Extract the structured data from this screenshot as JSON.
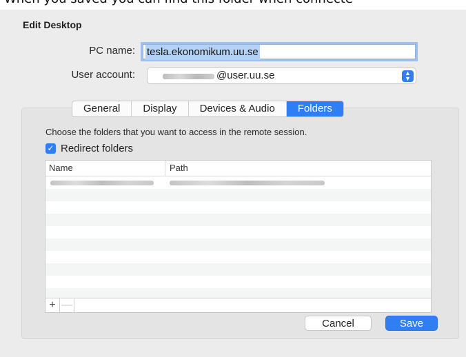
{
  "caption": "When you saved you can find this folder when connecte",
  "dialog": {
    "title": "Edit Desktop",
    "pc_name_label": "PC name:",
    "pc_name_value": "tesla.ekonomikum.uu.se",
    "user_account_label": "User account:",
    "user_account_value": "@user.uu.se"
  },
  "tabs": [
    "General",
    "Display",
    "Devices & Audio",
    "Folders"
  ],
  "active_tab": "Folders",
  "folders": {
    "instruction": "Choose the folders that you want to access in the remote session.",
    "redirect_label": "Redirect folders",
    "redirect_checked": true,
    "columns": {
      "name": "Name",
      "path": "Path"
    },
    "add_symbol": "+",
    "remove_symbol": "—"
  },
  "buttons": {
    "cancel": "Cancel",
    "save": "Save"
  },
  "colors": {
    "accent": "#2e7ef4",
    "panel": "#ececec"
  }
}
